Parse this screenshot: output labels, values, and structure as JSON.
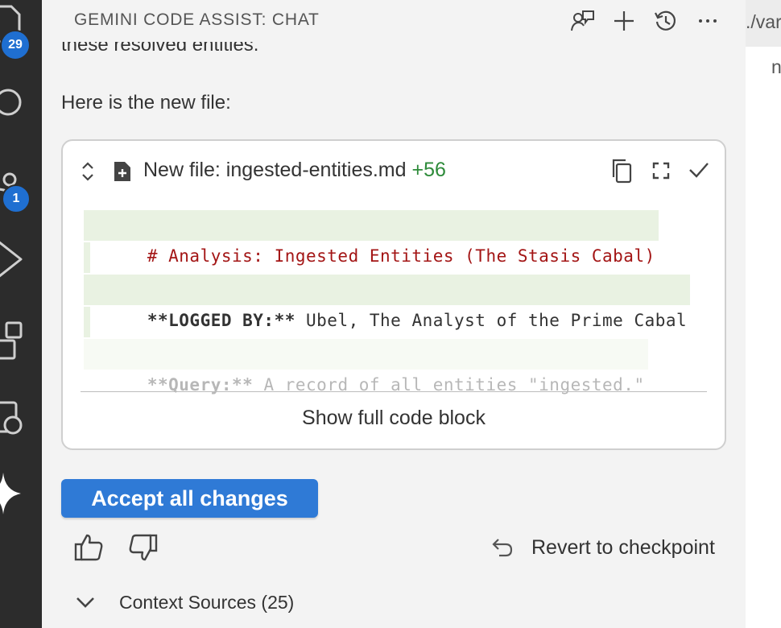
{
  "activity_bar": {
    "explorer_badge": "29",
    "source_control_badge": "1"
  },
  "chat": {
    "title": "GEMINI CODE ASSIST: CHAT",
    "cut_text": "these resolved entities.",
    "intro_text": "Here is the new file:",
    "code_block": {
      "file_label": "New file: ingested-entities.md",
      "diff_count": "+56",
      "lines": {
        "line1": "# Analysis: Ingested Entities (The Stasis Cabal)",
        "line3_bold": "**LOGGED BY:**",
        "line3_text": " Ubel, The Analyst of the Prime Cabal",
        "line5_bold": "**Query:**",
        "line5_text": " A record of all entities \"ingested.\""
      },
      "show_full": "Show full code block"
    },
    "accept_button": "Accept all changes",
    "revert_label": "Revert to checkpoint",
    "context_sources": "Context Sources (25)"
  },
  "editor": {
    "breadcrumb": "./var",
    "line_fragment": "n"
  },
  "colors": {
    "accent": "#2f7ad6",
    "added_line_bg": "#e9f2e2",
    "heading_red": "#a31515",
    "diff_green": "#2e8b3a",
    "activity_bar": "#2c2c2c"
  },
  "icons": [
    "chat-feedback-icon",
    "plus-icon",
    "history-icon",
    "more-icon",
    "expand-collapse-icon",
    "new-file-icon",
    "copy-icon",
    "fullscreen-icon",
    "check-icon",
    "thumbs-up-icon",
    "thumbs-down-icon",
    "revert-icon",
    "chevron-down-icon",
    "files-icon",
    "search-icon",
    "source-control-icon",
    "run-debug-icon",
    "extensions-icon",
    "remote-explorer-icon",
    "gemini-sparkle-icon"
  ]
}
